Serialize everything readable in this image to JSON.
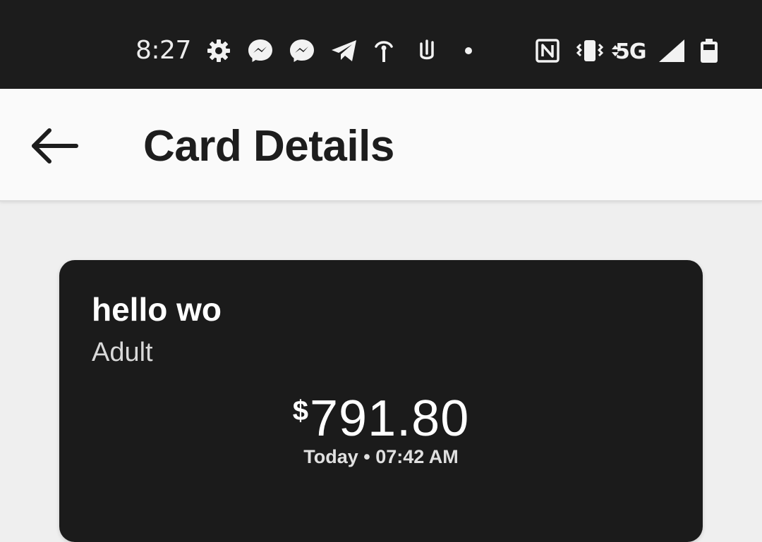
{
  "status_bar": {
    "time": "8:27",
    "network": "5G",
    "icons": [
      "gear-icon",
      "messenger-icon",
      "messenger-icon",
      "telegram-icon",
      "hotspot-icon",
      "clip-icon",
      "dot-icon",
      "nfc-icon",
      "vibrate-icon",
      "data-arrows-icon",
      "signal-icon",
      "battery-icon"
    ]
  },
  "app_bar": {
    "title": "Card Details",
    "back_icon": "back-arrow-icon"
  },
  "card": {
    "name": "hello wo",
    "type": "Adult",
    "currency_symbol": "$",
    "balance": "791.80",
    "updated": "Today • 07:42 AM"
  },
  "colors": {
    "status_bar_bg": "#1c1c1c",
    "app_bar_bg": "#fafafa",
    "page_bg": "#efefef",
    "card_bg": "#1b1b1b"
  }
}
